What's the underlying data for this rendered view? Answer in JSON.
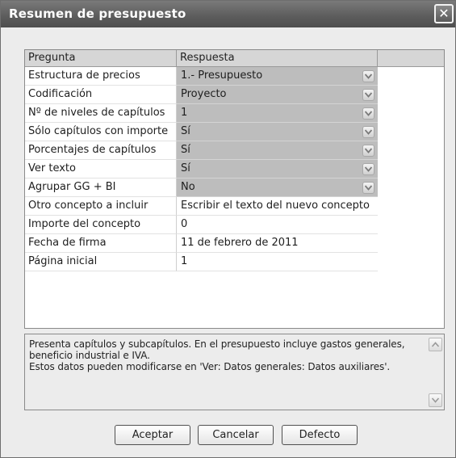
{
  "window": {
    "title": "Resumen de presupuesto",
    "close_symbol": "✕"
  },
  "grid": {
    "headers": [
      "Pregunta",
      "Respuesta",
      ""
    ],
    "rows": [
      {
        "question": "Estructura de precios",
        "answer": "1.- Presupuesto",
        "type": "combo"
      },
      {
        "question": "Codificación",
        "answer": "Proyecto",
        "type": "combo"
      },
      {
        "question": "Nº de niveles de capítulos",
        "answer": "1",
        "type": "combo"
      },
      {
        "question": "Sólo capítulos con importe",
        "answer": "Sí",
        "type": "combo"
      },
      {
        "question": "Porcentajes de capítulos",
        "answer": "Sí",
        "type": "combo"
      },
      {
        "question": "Ver texto",
        "answer": "Sí",
        "type": "combo"
      },
      {
        "question": "Agrupar GG + BI",
        "answer": "No",
        "type": "combo"
      },
      {
        "question": "Otro concepto a incluir",
        "answer": "Escribir el texto del nuevo concepto",
        "type": "text"
      },
      {
        "question": "Importe del concepto",
        "answer": "0",
        "type": "text"
      },
      {
        "question": "Fecha de firma",
        "answer": "11 de febrero de 2011",
        "type": "text"
      },
      {
        "question": "Página inicial",
        "answer": "1",
        "type": "text"
      }
    ]
  },
  "description": {
    "line1": "Presenta capítulos y subcapítulos. En el presupuesto incluye gastos generales,",
    "line2": "beneficio industrial e IVA.",
    "line3": "Estos datos pueden modificarse en 'Ver: Datos generales: Datos auxiliares'."
  },
  "buttons": {
    "accept": "Aceptar",
    "cancel": "Cancelar",
    "default": "Defecto"
  },
  "icons": {
    "dropdown": "chevron-down-icon",
    "scroll_up": "arrow-up-icon",
    "scroll_down": "arrow-down-icon",
    "close": "close-icon"
  }
}
